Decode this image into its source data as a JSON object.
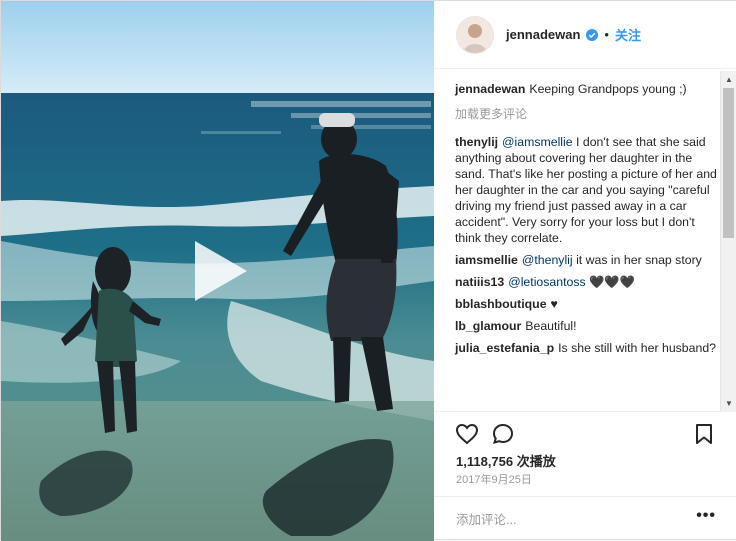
{
  "post": {
    "username": "jennadewan",
    "follow_label": "关注",
    "dot": "•",
    "views": "1,118,756 次播放",
    "date": "2017年9月25日",
    "add_comment_placeholder": "添加评论...",
    "more": "•••"
  },
  "comments": {
    "caption": {
      "user": "jennadewan",
      "text": "Keeping Grandpops young ;)"
    },
    "load_more": "加载更多评论",
    "items": [
      {
        "user": "thenylij",
        "mention": "@iamsmellie",
        "text": " I don't see that she said anything about covering her daughter in the sand. That's like her posting a picture of her and her daughter in the car and you saying \"careful driving my friend just passed away in a car accident\". Very sorry for your loss but I don't think they correlate."
      },
      {
        "user": "iamsmellie",
        "mention": "@thenylij",
        "text": " it was in her snap story"
      },
      {
        "user": "natiiis13",
        "mention": "@letiosantoss",
        "text": " 🖤🖤🖤"
      },
      {
        "user": "bblashboutique",
        "mention": "",
        "text": "♥"
      },
      {
        "user": "lb_glamour",
        "mention": "",
        "text": "Beautiful!"
      },
      {
        "user": "julia_estefania_p",
        "mention": "",
        "text": "Is she still with her husband?"
      }
    ]
  },
  "colors": {
    "link": "#3897f0",
    "mention": "#003569",
    "muted": "#999999"
  },
  "icons": [
    "heart-icon",
    "comment-icon",
    "bookmark-icon",
    "play-icon",
    "verified-icon"
  ]
}
